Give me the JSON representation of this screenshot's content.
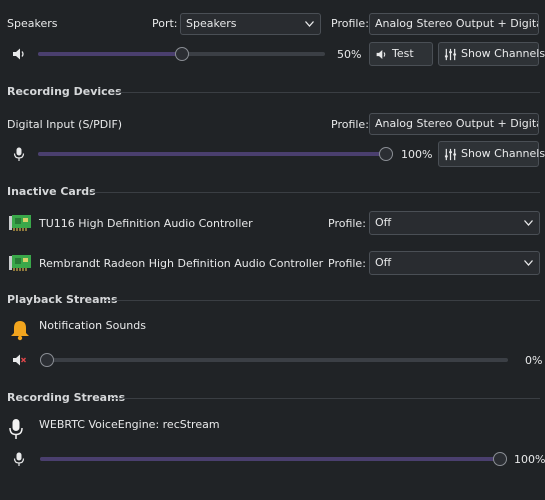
{
  "output": {
    "device_name": "Speakers",
    "port_label": "Port:",
    "port_value": "Speakers",
    "profile_label": "Profile:",
    "profile_value": "Analog Stereo Output + Digital",
    "volume": 0.5,
    "volume_text": "50%",
    "test_label": "Test",
    "show_channels_label": "Show Channels"
  },
  "recording_devices": {
    "section_title": "Recording Devices",
    "device_name": "Digital Input (S/PDIF)",
    "profile_label": "Profile:",
    "profile_value": "Analog Stereo Output + Digital",
    "volume": 1.0,
    "volume_text": "100%",
    "show_channels_label": "Show Channels"
  },
  "inactive_cards": {
    "section_title": "Inactive Cards",
    "cards": [
      {
        "name": "TU116 High Definition Audio Controller",
        "profile_label": "Profile:",
        "profile_value": "Off"
      },
      {
        "name": "Rembrandt Radeon High Definition Audio Controller",
        "profile_label": "Profile:",
        "profile_value": "Off"
      }
    ]
  },
  "playback_streams": {
    "section_title": "Playback Streams",
    "stream_name": "Notification Sounds",
    "volume": 0.0,
    "volume_text": "0%",
    "muted": true
  },
  "recording_streams": {
    "section_title": "Recording Streams",
    "stream_name": "WEBRTC VoiceEngine: recStream",
    "volume": 1.0,
    "volume_text": "100%"
  },
  "colors": {
    "background": "#202326",
    "slider_fill": "#4a3f6e",
    "bell": "#f2a51e",
    "card_green": "#3aa84a"
  }
}
